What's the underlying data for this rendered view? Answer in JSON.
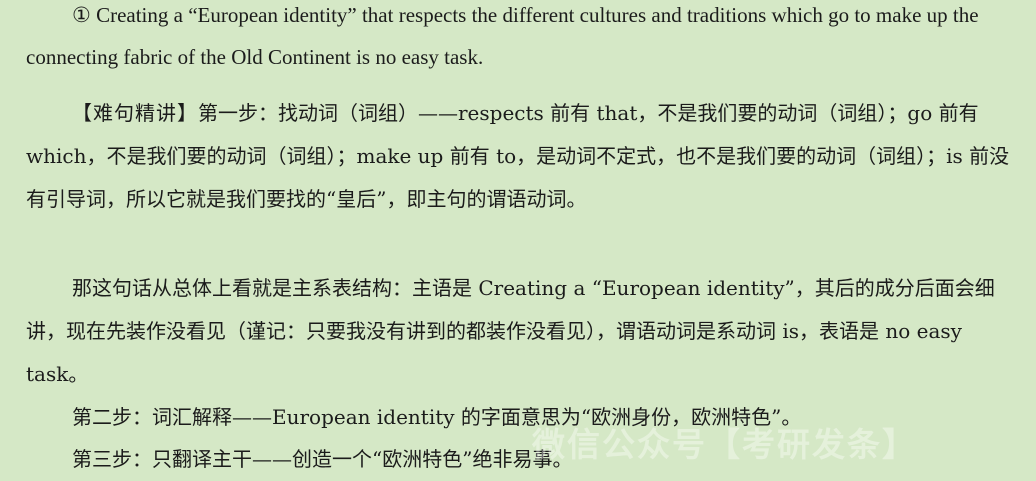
{
  "paragraphs": {
    "p1": "① Creating a “European identity” that respects the different cultures and traditions which go to make up the connecting fabric of the Old Continent is no easy task.",
    "p2_label": "【难句精讲】",
    "p2_body": "第一步：找动词（词组）——respects 前有 that，不是我们要的动词（词组）；go 前有 which，不是我们要的动词（词组）；make up 前有 to，是动词不定式，也不是我们要的动词（词组）；is 前没有引导词，所以它就是我们要找的“皇后”，即主句的谓语动词。",
    "p3": "那这句话从总体上看就是主系表结构：主语是 Creating a “European identity”，其后的成分后面会细讲，现在先装作没看见（谨记：只要我没有讲到的都装作没看见），谓语动词是系动词 is，表语是 no easy task。",
    "p4": "第二步：词汇解释——European identity 的字面意思为“欧洲身份，欧洲特色”。",
    "p5": "第三步：只翻译主干——创造一个“欧洲特色”绝非易事。"
  },
  "watermark": "微信公众号【考研发条】",
  "colors": {
    "background": "#d5e8c6",
    "text": "#1b1b1b"
  }
}
